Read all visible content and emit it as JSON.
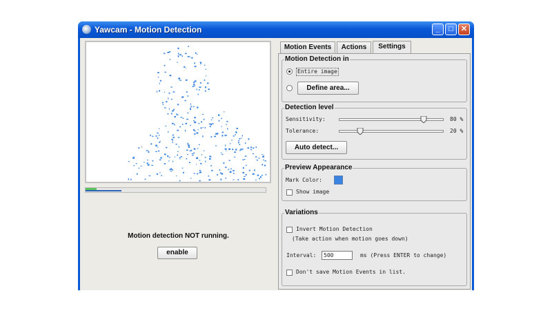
{
  "window": {
    "title": "Yawcam - Motion Detection",
    "controls": {
      "minimize": "_",
      "maximize": "□",
      "close": "✕"
    }
  },
  "left": {
    "status_text": "Motion detection NOT running.",
    "enable_label": "enable",
    "progress_level": 0.2
  },
  "tabs": [
    {
      "label": "Motion Events",
      "selected": false
    },
    {
      "label": "Actions",
      "selected": false
    },
    {
      "label": "Settings",
      "selected": true
    }
  ],
  "settings": {
    "detect_in": {
      "title": "Motion Detection in",
      "entire_image": "Entire image",
      "entire_selected": true,
      "define_area_button": "Define area..."
    },
    "detection_level": {
      "title": "Detection level",
      "sensitivity_label": "Sensitivity:",
      "sensitivity_value": 80,
      "sensitivity_text": "80 %",
      "tolerance_label": "Tolerance:",
      "tolerance_value": 20,
      "tolerance_text": "20 %",
      "auto_detect_button": "Auto detect..."
    },
    "preview_appearance": {
      "title": "Preview Appearance",
      "mark_color_label": "Mark Color:",
      "mark_color": "#3a83e0",
      "show_image_label": "Show image",
      "show_image_checked": false
    },
    "variations": {
      "title": "Variations",
      "invert_label": "Invert Motion Detection",
      "invert_checked": false,
      "invert_note": "(Take action when motion goes down)",
      "interval_label": "Interval:",
      "interval_value": "500",
      "interval_hint": "ms (Press ENTER to change)",
      "dont_save_label": "Don't save Motion Events in list.",
      "dont_save_checked": false
    }
  },
  "colors": {
    "titlebar": "#0a58d6",
    "motion_marks": "#3a83e0"
  }
}
